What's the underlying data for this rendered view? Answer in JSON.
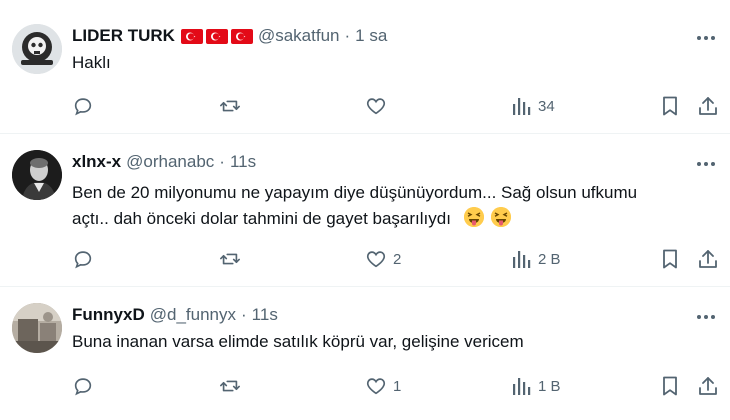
{
  "tweets": [
    {
      "name": "LIDER TURK",
      "handle": "@sakatfun",
      "separator": "·",
      "time": "1 sa",
      "text_lines": [
        "Haklı"
      ],
      "replies": "",
      "retweets": "",
      "likes": "",
      "views": "34",
      "flags": 3,
      "avatar_icon": "skull-emblem-avatar"
    },
    {
      "name": "xlnx-x",
      "handle": "@orhanabc",
      "separator": "·",
      "time": "11s",
      "text_lines": [
        "Ben de 20 milyonumu ne yapayım diye düşünüyordum... Sağ olsun ufkumu",
        "açtı.. dah önceki dolar tahmini de gayet başarılıydı"
      ],
      "emoji": [
        "squinting-face-with-tongue",
        "squinting-face-with-tongue"
      ],
      "replies": "",
      "retweets": "",
      "likes": "2",
      "views": "2 B",
      "avatar_icon": "portrait-photo-avatar"
    },
    {
      "name": "FunnyxD",
      "handle": "@d_funnyx",
      "separator": "·",
      "time": "11s",
      "text_lines": [
        "Buna inanan varsa elimde satılık köprü var, gelişine vericem"
      ],
      "replies": "",
      "retweets": "",
      "likes": "1",
      "views": "1 B",
      "avatar_icon": "room-photo-avatar"
    }
  ],
  "colors": {
    "text": "#0f1419",
    "secondary": "#536471",
    "divider": "#eff3f4",
    "flag_red": "#e30a17"
  }
}
